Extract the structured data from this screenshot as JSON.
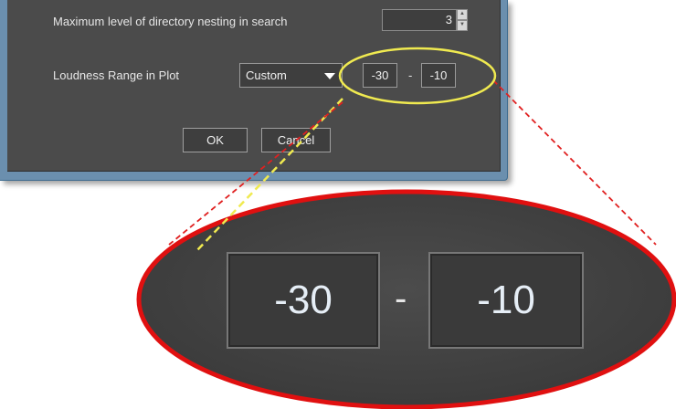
{
  "dialog": {
    "nesting_label": "Maximum level of directory nesting in search",
    "nesting_value": "3",
    "loudness_label": "Loudness Range in Plot",
    "range_mode": "Custom",
    "range_min": "-30",
    "range_separator": "-",
    "range_max": "-10",
    "ok_label": "OK",
    "cancel_label": "Cancel"
  },
  "zoom": {
    "range_min": "-30",
    "range_separator": "-",
    "range_max": "-10"
  },
  "colors": {
    "dialog_bg": "#4b4b4b",
    "highlight_circle": "#f0ea50",
    "zoom_ellipse_border": "#e01010",
    "callout_lines": "#e02020"
  }
}
